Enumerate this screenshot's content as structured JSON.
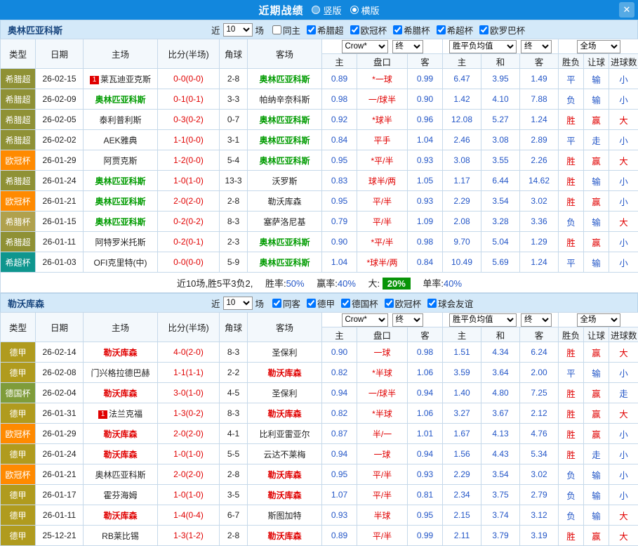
{
  "topbar": {
    "title": "近期战绩",
    "layout_options": [
      {
        "label": "竖版",
        "selected": false
      },
      {
        "label": "横版",
        "selected": true
      }
    ],
    "close_label": "✕"
  },
  "columns": [
    "类型",
    "日期",
    "主场",
    "比分(半场)",
    "角球",
    "客场"
  ],
  "subcolumns": [
    "主",
    "盘口",
    "客",
    "主",
    "和",
    "客",
    "胜负",
    "让球",
    "进球数"
  ],
  "type_colors": {
    "希腊超": "#8f9135",
    "欧冠杯": "#ff8a00",
    "希腊杯": "#b0a14d",
    "希超杯": "#0f968e",
    "德甲": "#b09b1e",
    "德国杯": "#7f9c3a"
  },
  "accent": {
    "red": "#e00000",
    "blue": "#2356c7",
    "green_badge": "#089408"
  },
  "sections": [
    {
      "team": "奥林匹亚科斯",
      "focal_color": "#009b00",
      "recent": {
        "pre": "近",
        "count": "10",
        "post": "场"
      },
      "filters": [
        {
          "label": "同主",
          "checked": false
        },
        {
          "label": "希腊超",
          "checked": true
        },
        {
          "label": "欧冠杯",
          "checked": true
        },
        {
          "label": "希腊杯",
          "checked": true
        },
        {
          "label": "希超杯",
          "checked": true
        },
        {
          "label": "欧罗巴杯",
          "checked": true
        }
      ],
      "dropdowns": {
        "bookmaker": "Crow*",
        "asian_stage": "终",
        "europe": "胜平负均值",
        "europe_stage": "终",
        "scope": "全场"
      },
      "rows": [
        {
          "type": "希腊超",
          "date": "26-02-15",
          "home": "莱瓦迪亚克斯",
          "home_badge": "1",
          "score": "0-0(0-0)",
          "corners": "2-8",
          "away": "奥林匹亚科斯",
          "away_focal": true,
          "ah": "0.89",
          "handicap": "*一球",
          "aa": "0.99",
          "eh": "6.47",
          "ed": "3.95",
          "ea": "1.49",
          "res": [
            "平",
            "输",
            "小"
          ]
        },
        {
          "type": "希腊超",
          "date": "26-02-09",
          "home": "奥林匹亚科斯",
          "home_focal": true,
          "score": "0-1(0-1)",
          "corners": "3-3",
          "away": "帕纳辛奈科斯",
          "ah": "0.98",
          "handicap": "一/球半",
          "aa": "0.90",
          "eh": "1.42",
          "ed": "4.10",
          "ea": "7.88",
          "res": [
            "负",
            "输",
            "小"
          ]
        },
        {
          "type": "希腊超",
          "date": "26-02-05",
          "home": "泰利普利斯",
          "score": "0-3(0-2)",
          "corners": "0-7",
          "away": "奥林匹亚科斯",
          "away_focal": true,
          "ah": "0.92",
          "handicap": "*球半",
          "aa": "0.96",
          "eh": "12.08",
          "ed": "5.27",
          "ea": "1.24",
          "res": [
            "胜",
            "赢",
            "大"
          ]
        },
        {
          "type": "希腊超",
          "date": "26-02-02",
          "home": "AEK雅典",
          "score": "1-1(0-0)",
          "corners": "3-1",
          "away": "奥林匹亚科斯",
          "away_focal": true,
          "ah": "0.84",
          "handicap": "平手",
          "aa": "1.04",
          "eh": "2.46",
          "ed": "3.08",
          "ea": "2.89",
          "res": [
            "平",
            "走",
            "小"
          ]
        },
        {
          "type": "欧冠杯",
          "date": "26-01-29",
          "home": "阿贾克斯",
          "score": "1-2(0-0)",
          "corners": "5-4",
          "away": "奥林匹亚科斯",
          "away_focal": true,
          "ah": "0.95",
          "handicap": "*平/半",
          "aa": "0.93",
          "eh": "3.08",
          "ed": "3.55",
          "ea": "2.26",
          "res": [
            "胜",
            "赢",
            "大"
          ]
        },
        {
          "type": "希腊超",
          "date": "26-01-24",
          "home": "奥林匹亚科斯",
          "home_focal": true,
          "score": "1-0(1-0)",
          "corners": "13-3",
          "away": "沃罗斯",
          "ah": "0.83",
          "handicap": "球半/两",
          "aa": "1.05",
          "eh": "1.17",
          "ed": "6.44",
          "ea": "14.62",
          "res": [
            "胜",
            "输",
            "小"
          ]
        },
        {
          "type": "欧冠杯",
          "date": "26-01-21",
          "home": "奥林匹亚科斯",
          "home_focal": true,
          "score": "2-0(2-0)",
          "corners": "2-8",
          "away": "勒沃库森",
          "ah": "0.95",
          "handicap": "平/半",
          "aa": "0.93",
          "eh": "2.29",
          "ed": "3.54",
          "ea": "3.02",
          "res": [
            "胜",
            "赢",
            "小"
          ]
        },
        {
          "type": "希腊杯",
          "date": "26-01-15",
          "home": "奥林匹亚科斯",
          "home_focal": true,
          "score": "0-2(0-2)",
          "corners": "8-3",
          "away": "塞萨洛尼基",
          "ah": "0.79",
          "handicap": "平/半",
          "aa": "1.09",
          "eh": "2.08",
          "ed": "3.28",
          "ea": "3.36",
          "res": [
            "负",
            "输",
            "大"
          ]
        },
        {
          "type": "希腊超",
          "date": "26-01-11",
          "home": "阿特罗米托斯",
          "score": "0-2(0-1)",
          "corners": "2-3",
          "away": "奥林匹亚科斯",
          "away_focal": true,
          "ah": "0.90",
          "handicap": "*平/半",
          "aa": "0.98",
          "eh": "9.70",
          "ed": "5.04",
          "ea": "1.29",
          "res": [
            "胜",
            "赢",
            "小"
          ]
        },
        {
          "type": "希超杯",
          "date": "26-01-03",
          "home": "OFI克里特(中)",
          "score": "0-0(0-0)",
          "corners": "5-9",
          "away": "奥林匹亚科斯",
          "away_focal": true,
          "ah": "1.04",
          "handicap": "*球半/两",
          "aa": "0.84",
          "eh": "10.49",
          "ed": "5.69",
          "ea": "1.24",
          "res": [
            "平",
            "输",
            "小"
          ]
        }
      ],
      "summary": {
        "prefix": "近10场,胜5平3负2,",
        "win_rate_label": "胜率:",
        "win_rate": "50%",
        "cover_rate_label": "赢率:",
        "cover_rate": "40%",
        "big_rate_label": "大:",
        "big_rate": "20%",
        "single_rate_label": "单率:",
        "single_rate": "40%"
      }
    },
    {
      "team": "勒沃库森",
      "focal_color": "#e00000",
      "recent": {
        "pre": "近",
        "count": "10",
        "post": "场"
      },
      "filters": [
        {
          "label": "同客",
          "checked": true
        },
        {
          "label": "德甲",
          "checked": true
        },
        {
          "label": "德国杯",
          "checked": true
        },
        {
          "label": "欧冠杯",
          "checked": true
        },
        {
          "label": "球会友谊",
          "checked": true
        }
      ],
      "dropdowns": {
        "bookmaker": "Crow*",
        "asian_stage": "终",
        "europe": "胜平负均值",
        "europe_stage": "终",
        "scope": "全场"
      },
      "rows": [
        {
          "type": "德甲",
          "date": "26-02-14",
          "home": "勒沃库森",
          "home_focal": true,
          "score": "4-0(2-0)",
          "corners": "8-3",
          "away": "圣保利",
          "ah": "0.90",
          "handicap": "一球",
          "aa": "0.98",
          "eh": "1.51",
          "ed": "4.34",
          "ea": "6.24",
          "res": [
            "胜",
            "赢",
            "大"
          ]
        },
        {
          "type": "德甲",
          "date": "26-02-08",
          "home": "门兴格拉德巴赫",
          "score": "1-1(1-1)",
          "corners": "2-2",
          "away": "勒沃库森",
          "away_focal": true,
          "ah": "0.82",
          "handicap": "*半球",
          "aa": "1.06",
          "eh": "3.59",
          "ed": "3.64",
          "ea": "2.00",
          "res": [
            "平",
            "输",
            "小"
          ]
        },
        {
          "type": "德国杯",
          "date": "26-02-04",
          "home": "勒沃库森",
          "home_focal": true,
          "score": "3-0(1-0)",
          "corners": "4-5",
          "away": "圣保利",
          "ah": "0.94",
          "handicap": "一/球半",
          "aa": "0.94",
          "eh": "1.40",
          "ed": "4.80",
          "ea": "7.25",
          "res": [
            "胜",
            "赢",
            "走"
          ]
        },
        {
          "type": "德甲",
          "date": "26-01-31",
          "home": "法兰克福",
          "home_badge": "1",
          "score": "1-3(0-2)",
          "corners": "8-3",
          "away": "勒沃库森",
          "away_focal": true,
          "ah": "0.82",
          "handicap": "*半球",
          "aa": "1.06",
          "eh": "3.27",
          "ed": "3.67",
          "ea": "2.12",
          "res": [
            "胜",
            "赢",
            "大"
          ]
        },
        {
          "type": "欧冠杯",
          "date": "26-01-29",
          "home": "勒沃库森",
          "home_focal": true,
          "score": "2-0(2-0)",
          "corners": "4-1",
          "away": "比利亚雷亚尔",
          "ah": "0.87",
          "handicap": "半/一",
          "aa": "1.01",
          "eh": "1.67",
          "ed": "4.13",
          "ea": "4.76",
          "res": [
            "胜",
            "赢",
            "小"
          ]
        },
        {
          "type": "德甲",
          "date": "26-01-24",
          "home": "勒沃库森",
          "home_focal": true,
          "score": "1-0(1-0)",
          "corners": "5-5",
          "away": "云达不莱梅",
          "ah": "0.94",
          "handicap": "一球",
          "aa": "0.94",
          "eh": "1.56",
          "ed": "4.43",
          "ea": "5.34",
          "res": [
            "胜",
            "走",
            "小"
          ]
        },
        {
          "type": "欧冠杯",
          "date": "26-01-21",
          "home": "奥林匹亚科斯",
          "score": "2-0(2-0)",
          "corners": "2-8",
          "away": "勒沃库森",
          "away_focal": true,
          "ah": "0.95",
          "handicap": "平/半",
          "aa": "0.93",
          "eh": "2.29",
          "ed": "3.54",
          "ea": "3.02",
          "res": [
            "负",
            "输",
            "小"
          ]
        },
        {
          "type": "德甲",
          "date": "26-01-17",
          "home": "霍芬海姆",
          "score": "1-0(1-0)",
          "corners": "3-5",
          "away": "勒沃库森",
          "away_focal": true,
          "ah": "1.07",
          "handicap": "平/半",
          "aa": "0.81",
          "eh": "2.34",
          "ed": "3.75",
          "ea": "2.79",
          "res": [
            "负",
            "输",
            "小"
          ]
        },
        {
          "type": "德甲",
          "date": "26-01-11",
          "home": "勒沃库森",
          "home_focal": true,
          "score": "1-4(0-4)",
          "corners": "6-7",
          "away": "斯图加特",
          "ah": "0.93",
          "handicap": "半球",
          "aa": "0.95",
          "eh": "2.15",
          "ed": "3.74",
          "ea": "3.12",
          "res": [
            "负",
            "输",
            "大"
          ]
        },
        {
          "type": "德甲",
          "date": "25-12-21",
          "home": "RB莱比锡",
          "score": "1-3(1-2)",
          "corners": "2-8",
          "away": "勒沃库森",
          "away_focal": true,
          "ah": "0.89",
          "handicap": "平/半",
          "aa": "0.99",
          "eh": "2.11",
          "ed": "3.79",
          "ea": "3.19",
          "res": [
            "胜",
            "赢",
            "大"
          ]
        }
      ]
    }
  ]
}
